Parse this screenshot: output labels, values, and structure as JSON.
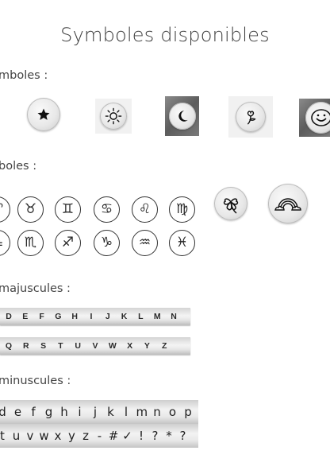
{
  "title": "Symboles disponibles",
  "sections": {
    "symbols_label": "mboles :",
    "more_symbols_label": "boles :",
    "uppercase_label": "majuscules :",
    "lowercase_label": "minuscules :"
  },
  "stamps": [
    {
      "icon": "star-icon"
    },
    {
      "icon": "sun-icon"
    },
    {
      "icon": "moon-icon"
    },
    {
      "icon": "flower-icon"
    },
    {
      "icon": "smiley-icon"
    }
  ],
  "zodiac_row1": [
    "♈",
    "♉",
    "♊",
    "♋",
    "♌",
    "♍"
  ],
  "zodiac_row2": [
    "♎",
    "♏",
    "♐",
    "♑",
    "♒",
    "♓"
  ],
  "extra_stamps": [
    {
      "icon": "clover-icon"
    },
    {
      "icon": "rainbow-icon"
    }
  ],
  "uppercase_row1": [
    "D",
    "E",
    "F",
    "G",
    "H",
    "I",
    "J",
    "K",
    "L",
    "M",
    "N"
  ],
  "uppercase_row2": [
    "Q",
    "R",
    "S",
    "T",
    "U",
    "V",
    "W",
    "X",
    "Y",
    "Z"
  ],
  "lowercase_row1": [
    "d",
    "e",
    "f",
    "g",
    "h",
    "i",
    "j",
    "k",
    "l",
    "m",
    "n",
    "o",
    "p"
  ],
  "lowercase_row2": [
    "t",
    "u",
    "v",
    "w",
    "x",
    "y",
    "z",
    "-",
    "#",
    "✓",
    "!",
    "?",
    "*",
    "?"
  ]
}
